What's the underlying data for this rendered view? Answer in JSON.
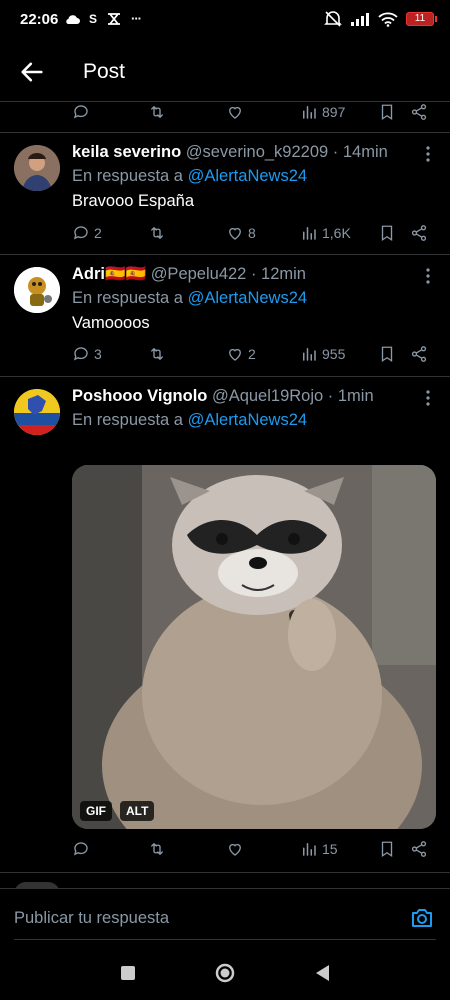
{
  "status_bar": {
    "time": "22:06",
    "carrier_letter": "S",
    "more_dots": "···",
    "battery": "11"
  },
  "header": {
    "title": "Post"
  },
  "top_actions": {
    "views": "897"
  },
  "tweets": [
    {
      "name": "keila severino",
      "handle": "@severino_k92209",
      "time": "· 14min",
      "reply_prefix": "En respuesta a",
      "mention": "@AlertaNews24",
      "text": "Bravooo España",
      "replies": "2",
      "likes": "8",
      "views": "1,6K"
    },
    {
      "name": "Adri🇪🇸🇪🇸",
      "handle": "@Pepelu422",
      "time": "· 12min",
      "reply_prefix": "En respuesta a",
      "mention": "@AlertaNews24",
      "text": "Vamoooos",
      "replies": "3",
      "likes": "2",
      "views": "955"
    },
    {
      "name": "Poshooo Vignolo",
      "handle": "@Aquel19Rojo",
      "time": "· 1min",
      "reply_prefix": "En respuesta a",
      "mention": "@AlertaNews24",
      "media_tags": [
        "GIF",
        "ALT"
      ],
      "views": "15"
    }
  ],
  "reply_box": {
    "placeholder": "Publicar tu respuesta"
  },
  "colors": {
    "accent": "#1d9bf0",
    "muted": "#8b98a5",
    "background": "#000000"
  }
}
